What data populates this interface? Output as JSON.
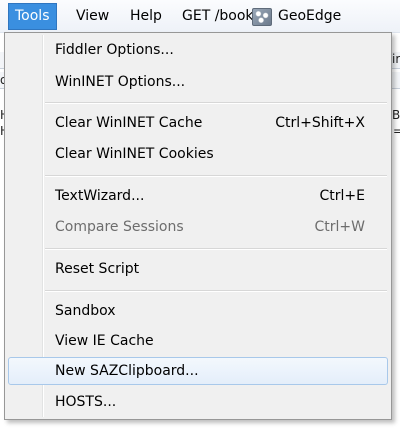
{
  "menubar": {
    "items": [
      {
        "label": "Tools"
      },
      {
        "label": "View"
      },
      {
        "label": "Help"
      },
      {
        "label": "GET /book"
      },
      {
        "label": "GeoEdge"
      }
    ]
  },
  "background": {
    "fragments": [
      "ir",
      "Be",
      "o",
      "H",
      "="
    ]
  },
  "tools_menu": {
    "items": [
      {
        "label": "Fiddler Options...",
        "shortcut": ""
      },
      {
        "label": "WinINET Options...",
        "shortcut": ""
      },
      {
        "label": "Clear WinINET Cache",
        "shortcut": "Ctrl+Shift+X"
      },
      {
        "label": "Clear WinINET Cookies",
        "shortcut": ""
      },
      {
        "label": "TextWizard...",
        "shortcut": "Ctrl+E"
      },
      {
        "label": "Compare Sessions",
        "shortcut": "Ctrl+W",
        "disabled": true
      },
      {
        "label": "Reset Script",
        "shortcut": ""
      },
      {
        "label": "Sandbox",
        "shortcut": ""
      },
      {
        "label": "View IE Cache",
        "shortcut": ""
      },
      {
        "label": "New SAZClipboard...",
        "shortcut": "",
        "highlighted": true
      },
      {
        "label": "HOSTS...",
        "shortcut": ""
      }
    ]
  }
}
